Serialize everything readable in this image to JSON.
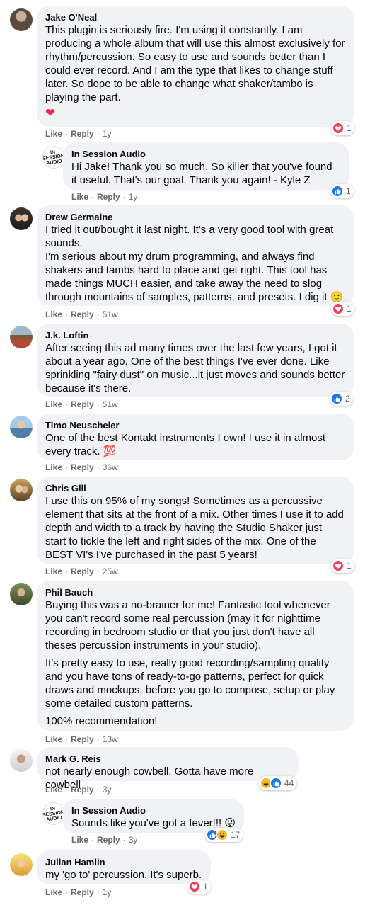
{
  "labels": {
    "like": "Like",
    "reply": "Reply",
    "dot": "·"
  },
  "colors": {
    "love": "#f33e58",
    "like": "#1877f2",
    "haha": "#f7b928",
    "bubble": "#f0f2f5",
    "meta": "#65676b"
  },
  "comments": [
    {
      "author": "Jake O'Neal",
      "avatar_icon": "profile-photo",
      "paragraphs": [
        "This plugin is seriously fire. I'm using it constantly. I am producing a whole album that will use this almost exclusively for rhythm/percussion. So easy to use and sounds better than I could ever record. And I am the type that likes to change stuff later. So dope to be able to change what shaker/tambo is playing the part."
      ],
      "trailing_emoji": "❤",
      "time": "1y",
      "reactions": {
        "icons": [
          "love"
        ],
        "count": "1"
      }
    },
    {
      "author": "In Session Audio",
      "avatar_icon": "in-session-audio-logo",
      "avatar_text": "IN SESSION AUDIO",
      "paragraphs": [
        "Hi Jake! Thank you so much. So killer that you've found it useful. That's our goal. Thank you again! - Kyle Z"
      ],
      "time": "1y",
      "reactions": {
        "icons": [
          "like"
        ],
        "count": "1"
      }
    },
    {
      "author": "Drew Germaine",
      "avatar_icon": "profile-photo",
      "paragraphs": [
        "I tried it out/bought it last night. It's a very good tool with great sounds.",
        "I'm serious about my drum programming, and always find shakers and tambs hard to place and get right. This tool has made things MUCH easier, and take away the need to slog through mountains of samples, patterns, and presets. I dig it 🙂"
      ],
      "time": "51w",
      "reactions": {
        "icons": [
          "love"
        ],
        "count": "1"
      }
    },
    {
      "author": "J.k. Loftin",
      "avatar_icon": "profile-photo",
      "paragraphs": [
        "After seeing this ad many times over the last few years, I got it about a year ago. One of the best things I've ever done. Like sprinkling \"fairy dust\" on music...it just moves and sounds better because it's there."
      ],
      "time": "51w",
      "reactions": {
        "icons": [
          "like"
        ],
        "count": "2"
      }
    },
    {
      "author": "Timo Neuscheler",
      "avatar_icon": "profile-photo",
      "paragraphs": [
        "One of the best Kontakt instruments I own! I use it in almost every track. 💯"
      ],
      "time": "36w",
      "reactions": null
    },
    {
      "author": "Chris Gill",
      "avatar_icon": "profile-photo",
      "paragraphs": [
        "I use this on 95% of my songs! Sometimes as a percussive element that sits at the front of a mix. Other times I use it to add depth and width to a track by having the Studio Shaker just start to tickle the left and right sides of the mix. One of the BEST VI's I've purchased in the past 5 years!"
      ],
      "time": "25w",
      "reactions": {
        "icons": [
          "love"
        ],
        "count": "1"
      }
    },
    {
      "author": "Phil Bauch",
      "avatar_icon": "profile-photo",
      "paragraphs": [
        "Buying this was a no-brainer for me! Fantastic tool whenever you can't record some real percussion (may it for nighttime recording in bedroom studio or that you just don't have all theses percussion instruments in your studio).",
        "It's pretty easy to use, really good recording/sampling quality and you have tons of ready-to-go patterns, perfect for quick draws and mockups, before you go to compose, setup or play some detailed custom patterns.",
        "100% recommendation!"
      ],
      "time": "13w",
      "reactions": null
    },
    {
      "author": "Mark G. Reis",
      "avatar_icon": "profile-photo",
      "paragraphs": [
        "not nearly enough cowbell. Gotta have more cowbell"
      ],
      "time": "3y",
      "reactions": {
        "icons": [
          "haha",
          "like"
        ],
        "count": "44"
      }
    },
    {
      "author": "In Session Audio",
      "avatar_icon": "in-session-audio-logo",
      "avatar_text": "IN SESSION AUDIO",
      "paragraphs": [
        "Sounds like you've got a fever!!! 😜"
      ],
      "time": "3y",
      "reactions": {
        "icons": [
          "like",
          "haha"
        ],
        "count": "17"
      }
    },
    {
      "author": "Julian Hamlin",
      "avatar_icon": "profile-photo",
      "paragraphs": [
        "my 'go to' percussion. It's superb."
      ],
      "time": "1y",
      "reactions": {
        "icons": [
          "love"
        ],
        "count": "1"
      }
    }
  ]
}
